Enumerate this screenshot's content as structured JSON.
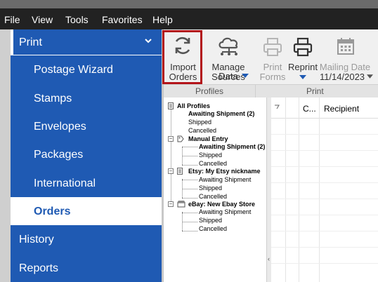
{
  "menu": [
    "File",
    "View",
    "Tools",
    "Favorites",
    "Help"
  ],
  "sidebar": {
    "print_label": "Print",
    "sub_items": [
      "Postage Wizard",
      "Stamps",
      "Envelopes",
      "Packages",
      "International",
      "Orders"
    ],
    "active_item": "Orders",
    "bottom_items": [
      "History",
      "Reports"
    ]
  },
  "ribbon": {
    "import_orders": [
      "Import",
      "Orders"
    ],
    "manage_data_sources": [
      "Manage Data",
      "Sources"
    ],
    "print_forms": [
      "Print",
      "Forms"
    ],
    "reprint": "Reprint",
    "mailing_date": [
      "Mailing Date",
      "11/14/2023"
    ],
    "groups": [
      "Profiles",
      "Print"
    ]
  },
  "profiles_tree": {
    "all_profiles": "All Profiles",
    "groups": [
      {
        "name": "",
        "children": [
          "Awaiting Shipment (2)",
          "Shipped",
          "Cancelled"
        ]
      },
      {
        "name": "Manual Entry",
        "children": [
          "Awaiting Shipment (2)",
          "Shipped",
          "Cancelled"
        ]
      },
      {
        "name": "Etsy: My Etsy nickname",
        "children": [
          "Awaiting Shipment",
          "Shipped",
          "Cancelled"
        ]
      },
      {
        "name": "eBay: New Ebay Store",
        "children": [
          "Awaiting Shipment",
          "Shipped",
          "Cancelled"
        ]
      }
    ]
  },
  "grid": {
    "columns": [
      "C...",
      "Recipient"
    ]
  },
  "colors": {
    "sidebar_blue": "#1f5ab3",
    "highlight_red": "#b3141a",
    "menubar": "#222222"
  }
}
